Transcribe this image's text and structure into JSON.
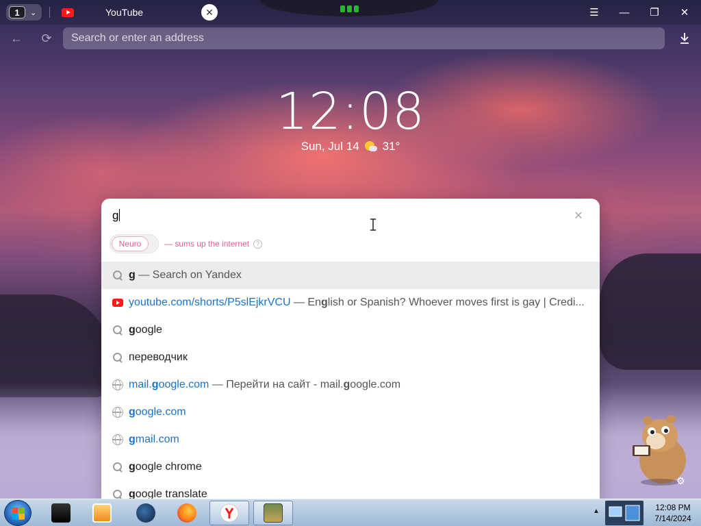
{
  "browser": {
    "tab_count": "1",
    "tab_title": "YouTube",
    "address_placeholder": "Search or enter an address"
  },
  "newtab": {
    "time": "12:08",
    "date": "Sun, Jul 14",
    "temperature": "31°"
  },
  "search": {
    "query": "g",
    "neuro_label": "Neuro",
    "neuro_desc": "— sums up the internet",
    "suggestions": [
      {
        "icon": "search-icon",
        "bold": "g",
        "text": " — Search on Yandex",
        "type": "query"
      },
      {
        "icon": "youtube-icon",
        "link": "youtube.com/shorts/P5slEjkrVCU",
        "desc_pre": " — En",
        "desc_bold": "g",
        "desc_post": "lish or Spanish? Whoever moves first is gay | Credi...",
        "type": "history"
      },
      {
        "icon": "search-icon",
        "bold": "g",
        "text": "oogle",
        "type": "query"
      },
      {
        "icon": "search-icon",
        "bold": "",
        "text": "переводчик",
        "type": "query"
      },
      {
        "icon": "globe-icon",
        "link_pre": "mail.",
        "link_bold": "g",
        "link_post": "oogle.com",
        "desc_pre": " — Перейти на сайт - mail.",
        "desc_bold": "g",
        "desc_post": "oogle.com",
        "type": "site"
      },
      {
        "icon": "globe-icon",
        "link_bold": "g",
        "link_post": "oogle.com",
        "type": "site"
      },
      {
        "icon": "globe-icon",
        "link_bold": "g",
        "link_post": "mail.com",
        "type": "site"
      },
      {
        "icon": "search-icon",
        "bold": "g",
        "text": "oogle chrome",
        "type": "query"
      },
      {
        "icon": "search-icon",
        "bold": "g",
        "text": "oogle translate",
        "type": "query"
      }
    ]
  },
  "taskbar": {
    "clock_time": "12:08 PM",
    "clock_date": "7/14/2024",
    "apps": [
      "device-manager-icon",
      "media-player-icon",
      "globe-app-icon",
      "firefox-icon",
      "yandex-browser-icon",
      "sandboxie-icon"
    ]
  },
  "colors": {
    "accent_link": "#1a73c9",
    "neuro_pink": "#e55a98",
    "youtube_red": "#ff1a1a"
  }
}
